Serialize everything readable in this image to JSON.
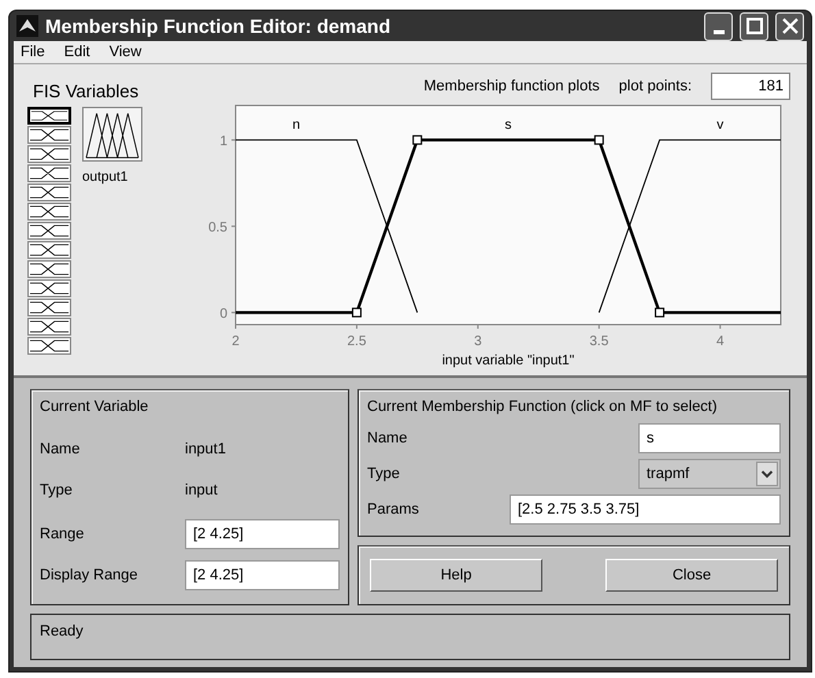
{
  "window": {
    "title": "Membership Function Editor: demand"
  },
  "menu": [
    "File",
    "Edit",
    "View"
  ],
  "fis_variables": {
    "title": "FIS Variables",
    "inputs": [
      {
        "selected": true
      },
      {
        "selected": false
      },
      {
        "selected": false
      },
      {
        "selected": false
      },
      {
        "selected": false
      },
      {
        "selected": false
      },
      {
        "selected": false
      },
      {
        "selected": false
      },
      {
        "selected": false
      },
      {
        "selected": false
      },
      {
        "selected": false
      },
      {
        "selected": false
      },
      {
        "selected": false
      }
    ],
    "output": {
      "label": "output1",
      "selected": false
    }
  },
  "plot_header": {
    "label": "Membership function plots",
    "plot_points_label": "plot points:",
    "plot_points": "181"
  },
  "chart_data": {
    "type": "line",
    "xlabel": "input variable \"input1\"",
    "x": [
      2,
      2.5,
      2.75,
      3.5,
      3.75,
      4.25
    ],
    "xlim": [
      2,
      4.25
    ],
    "ylim": [
      -0.07,
      1.2
    ],
    "xticks": [
      2,
      2.5,
      3,
      3.5,
      4
    ],
    "yticks": [
      0,
      0.5,
      1
    ],
    "series": [
      {
        "name": "n",
        "color": "#000000",
        "values": [
          1,
          1,
          0,
          null,
          null,
          null
        ]
      },
      {
        "name": "s",
        "color": "#000000",
        "values": [
          0,
          0,
          1,
          1,
          0,
          0
        ]
      },
      {
        "name": "v",
        "color": "#000000",
        "values": [
          null,
          null,
          null,
          0,
          1,
          1
        ]
      }
    ]
  },
  "membership_functions": [
    {
      "selected": false
    },
    {
      "selected": true
    },
    {
      "selected": false
    }
  ],
  "current_variable": {
    "title": "Current Variable",
    "name_label": "Name",
    "name": "input1",
    "type_label": "Type",
    "type": "input",
    "range_label": "Range",
    "range": "[2 4.25]",
    "display_range_label": "Display Range",
    "display_range": "[2 4.25]"
  },
  "current_mf": {
    "title": "Current Membership Function (click on MF to select)",
    "name_label": "Name",
    "name": "s",
    "type_label": "Type",
    "type": "trapmf",
    "params_label": "Params",
    "params": "[2.5 2.75 3.5 3.75]"
  },
  "buttons": [
    "Help",
    "Close"
  ],
  "status_bar": "Ready"
}
